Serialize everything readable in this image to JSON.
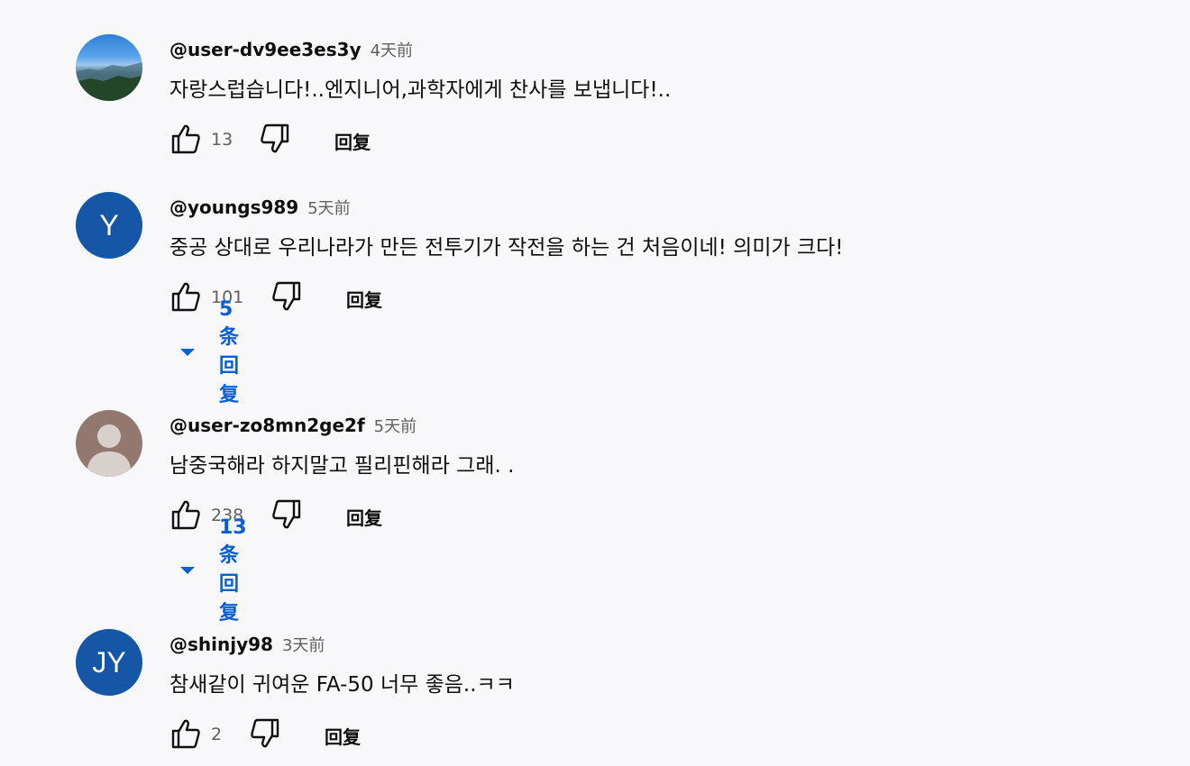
{
  "comments": [
    {
      "username": "@user-dv9ee3es3y",
      "time": "4天前",
      "text": "자랑스럽습니다!..엔지니어,과학자에게 찬사를 보냅니다!..",
      "likes": "13",
      "reply_label": "回复"
    },
    {
      "username": "@youngs989",
      "avatar_text": "Y",
      "time": "5天前",
      "text": "중공 상대로 우리나라가 만든 전투기가 작전을 하는 건 처음이네! 의미가 크다!",
      "likes": "101",
      "reply_label": "回复",
      "replies_text": "5 条回复"
    },
    {
      "username": "@user-zo8mn2ge2f",
      "time": "5天前",
      "text": "남중국해라 하지말고  필리핀해라  그래. .",
      "likes": "238",
      "reply_label": "回复",
      "replies_text": "13 条回复"
    },
    {
      "username": "@shinjy98",
      "avatar_text": "JY",
      "time": "3天前",
      "text": "참새같이 귀여운 FA-50 너무 좋음..ㅋㅋ",
      "likes": "2",
      "reply_label": "回复"
    }
  ],
  "colors": {
    "link_blue": "#065fd4",
    "avatar_blue": "#1557a6",
    "avatar_brown": "#92786e",
    "text": "#0f0f0f",
    "secondary": "#606060"
  },
  "icons": {
    "like": "thumb-up-icon",
    "dislike": "thumb-down-icon",
    "expand": "caret-down-icon",
    "default_avatar": "person-icon"
  }
}
